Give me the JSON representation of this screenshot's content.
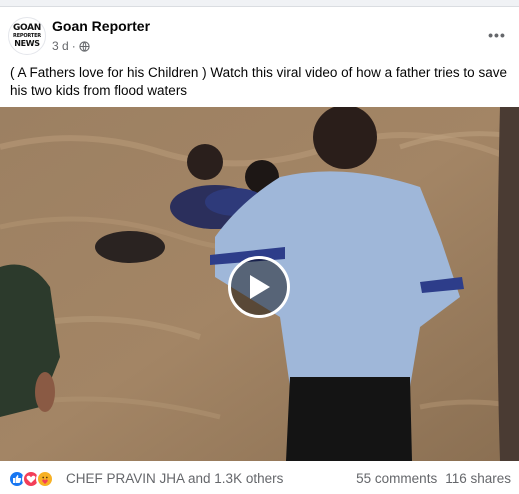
{
  "post": {
    "author": {
      "name": "Goan Reporter",
      "avatar_lines": [
        "GOAN",
        "REPORTER",
        "NEWS"
      ],
      "timestamp": "3 d",
      "separator": "·",
      "audience_icon": "globe-icon"
    },
    "more_icon": "more-horizontal-icon",
    "caption": "( A Fathers love for his Children ) Watch this viral video of how a father tries to save his two kids from flood waters",
    "video": {
      "play_icon": "play-icon"
    },
    "engagement": {
      "reaction_icons": [
        "like-icon",
        "love-icon",
        "care-icon"
      ],
      "reactors_text": "CHEF PRAVIN JHA and 1.3K others",
      "comments_text": "55 comments",
      "shares_text": "116 shares"
    }
  },
  "colors": {
    "like": "#1877f2",
    "love": "#f33e58",
    "care": "#f7b125",
    "muted_text": "#65676b"
  }
}
